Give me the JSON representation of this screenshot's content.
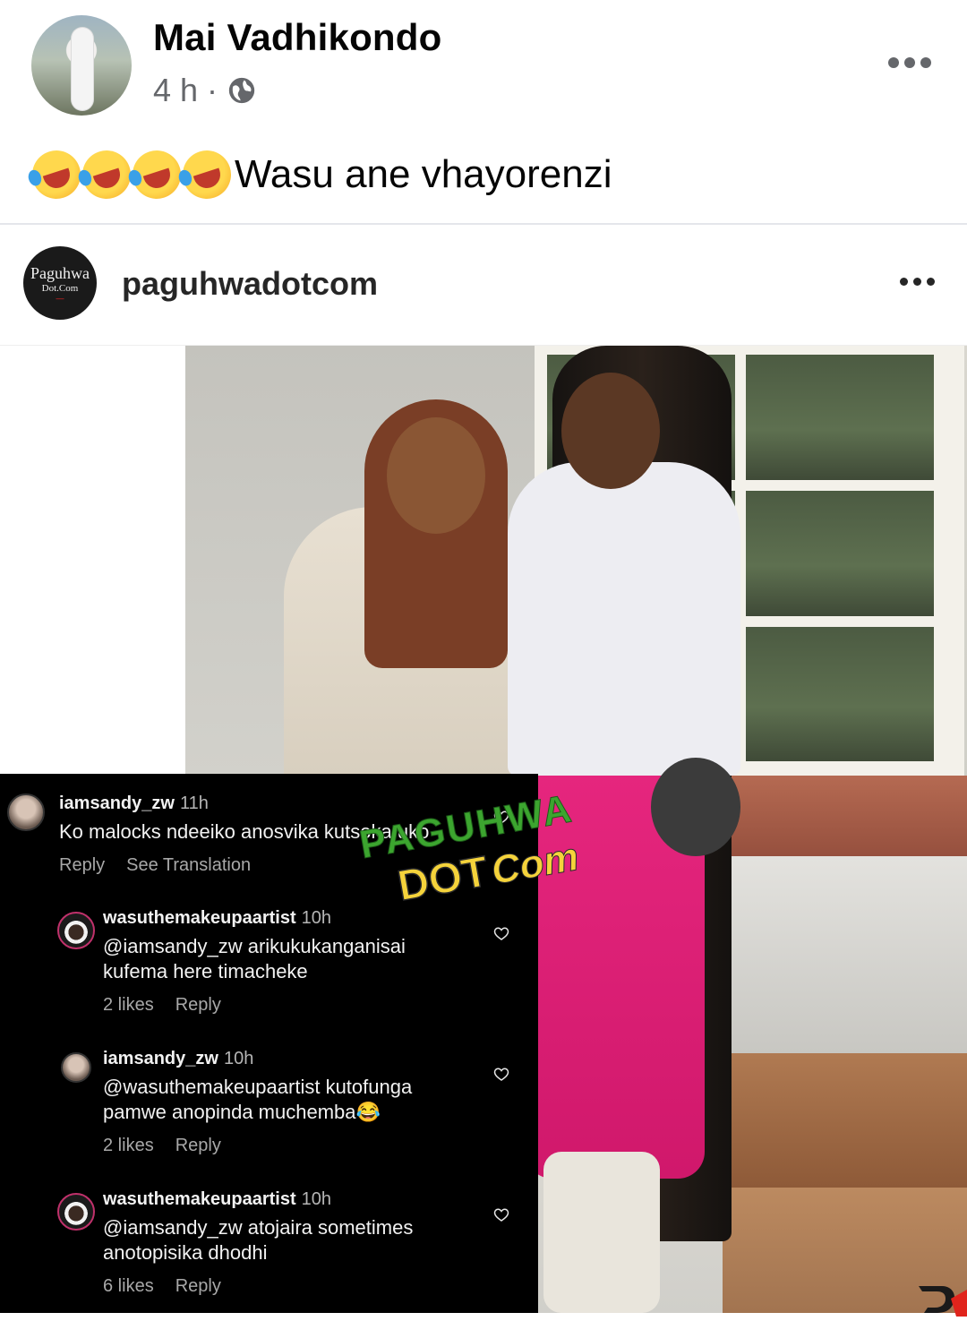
{
  "post": {
    "author_name": "Mai Vadhikondo",
    "time": "4 h",
    "separator": "·",
    "privacy_icon": "globe-icon",
    "text": "Wasu ane vhayorenzi",
    "emoji_count": 4,
    "emoji_name": "rolling-on-floor-laughing"
  },
  "shared": {
    "account_name": "paguhwadotcom",
    "logo_text": {
      "line1": "Paguhwa",
      "line2": "Dot.Com",
      "line3": "—"
    }
  },
  "watermark": {
    "line1": "PAGUHWA",
    "line2": "DOT",
    "line3": "Com"
  },
  "comments": [
    {
      "user": "iamsandy_zw",
      "time": "11h",
      "text": "Ko malocks ndeeiko anosvika kutsoka uko",
      "likes": "",
      "reply": "Reply",
      "translate": "See Translation"
    },
    {
      "user": "wasuthemakeupaartist",
      "time": "10h",
      "text_line1": "@iamsandy_zw arikukukanganisai",
      "text_line2": "kufema here timacheke",
      "likes": "2 likes",
      "reply": "Reply"
    },
    {
      "user": "iamsandy_zw",
      "time": "10h",
      "text_line1": "@wasuthemakeupaartist kutofunga",
      "text_line2": "pamwe anopinda muchemba😂",
      "likes": "2 likes",
      "reply": "Reply"
    },
    {
      "user": "wasuthemakeupaartist",
      "time": "10h",
      "text_line1": "@iamsandy_zw atojaira sometimes",
      "text_line2": "anotopisika dhodhi",
      "likes": "6 likes",
      "reply": "Reply"
    }
  ],
  "colors": {
    "meta_gray": "#65676b",
    "watermark_green": "#3ca52f",
    "watermark_yellow": "#f5d33b",
    "comment_bg": "#000000"
  }
}
